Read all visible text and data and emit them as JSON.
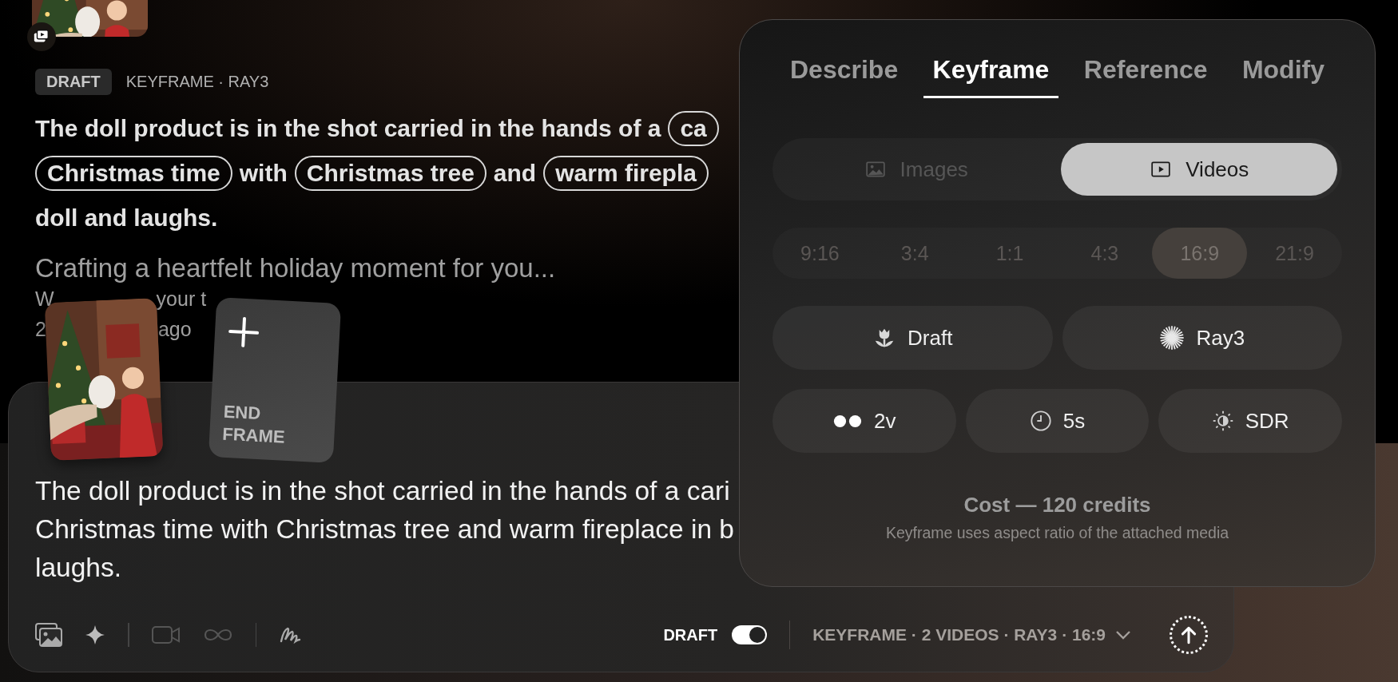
{
  "history": {
    "badge": "DRAFT",
    "meta": "KEYFRAME · RAY3",
    "prompt_lines": [
      [
        {
          "kind": "text",
          "text": "The doll product is in the shot carried in the hands of a"
        },
        {
          "kind": "tag",
          "text": "ca"
        }
      ],
      [
        {
          "kind": "tag",
          "text": "Christmas time"
        },
        {
          "kind": "text",
          "text": "with"
        },
        {
          "kind": "tag",
          "text": "Christmas tree"
        },
        {
          "kind": "text",
          "text": "and"
        },
        {
          "kind": "tag",
          "text": "warm firepla"
        }
      ],
      [
        {
          "kind": "text",
          "text": "doll and laughs."
        }
      ]
    ],
    "caption": "Crafting a heartfelt holiday moment for you...",
    "status_lines": [
      [
        "W",
        "your t"
      ],
      [
        "2",
        "ago"
      ]
    ]
  },
  "composer": {
    "end_frame_label": "END FRAME",
    "text_lines": [
      "The doll product is in the shot carried in the hands of a cari",
      "Christmas time with Christmas tree and warm fireplace in b",
      "laughs."
    ],
    "draft_label": "DRAFT",
    "draft_on": true,
    "summary": "KEYFRAME · 2 VIDEOS · RAY3 · 16:9"
  },
  "panel": {
    "tabs": [
      {
        "label": "Describe",
        "selected": false
      },
      {
        "label": "Keyframe",
        "selected": true
      },
      {
        "label": "Reference",
        "selected": false
      },
      {
        "label": "Modify",
        "selected": false
      }
    ],
    "media_types": [
      {
        "label": "Images",
        "selected": false
      },
      {
        "label": "Videos",
        "selected": true
      }
    ],
    "aspect_ratios": [
      {
        "label": "9:16",
        "selected": false
      },
      {
        "label": "3:4",
        "selected": false
      },
      {
        "label": "1:1",
        "selected": false
      },
      {
        "label": "4:3",
        "selected": false
      },
      {
        "label": "16:9",
        "selected": true
      },
      {
        "label": "21:9",
        "selected": false
      }
    ],
    "models": [
      {
        "kind": "draft",
        "label": "Draft"
      },
      {
        "kind": "ray",
        "label": "Ray3"
      }
    ],
    "options": [
      {
        "kind": "count",
        "label": "2v"
      },
      {
        "kind": "duration",
        "label": "5s"
      },
      {
        "kind": "range",
        "label": "SDR"
      }
    ],
    "cost": "Cost — 120 credits",
    "note": "Keyframe uses aspect ratio of the attached media"
  }
}
